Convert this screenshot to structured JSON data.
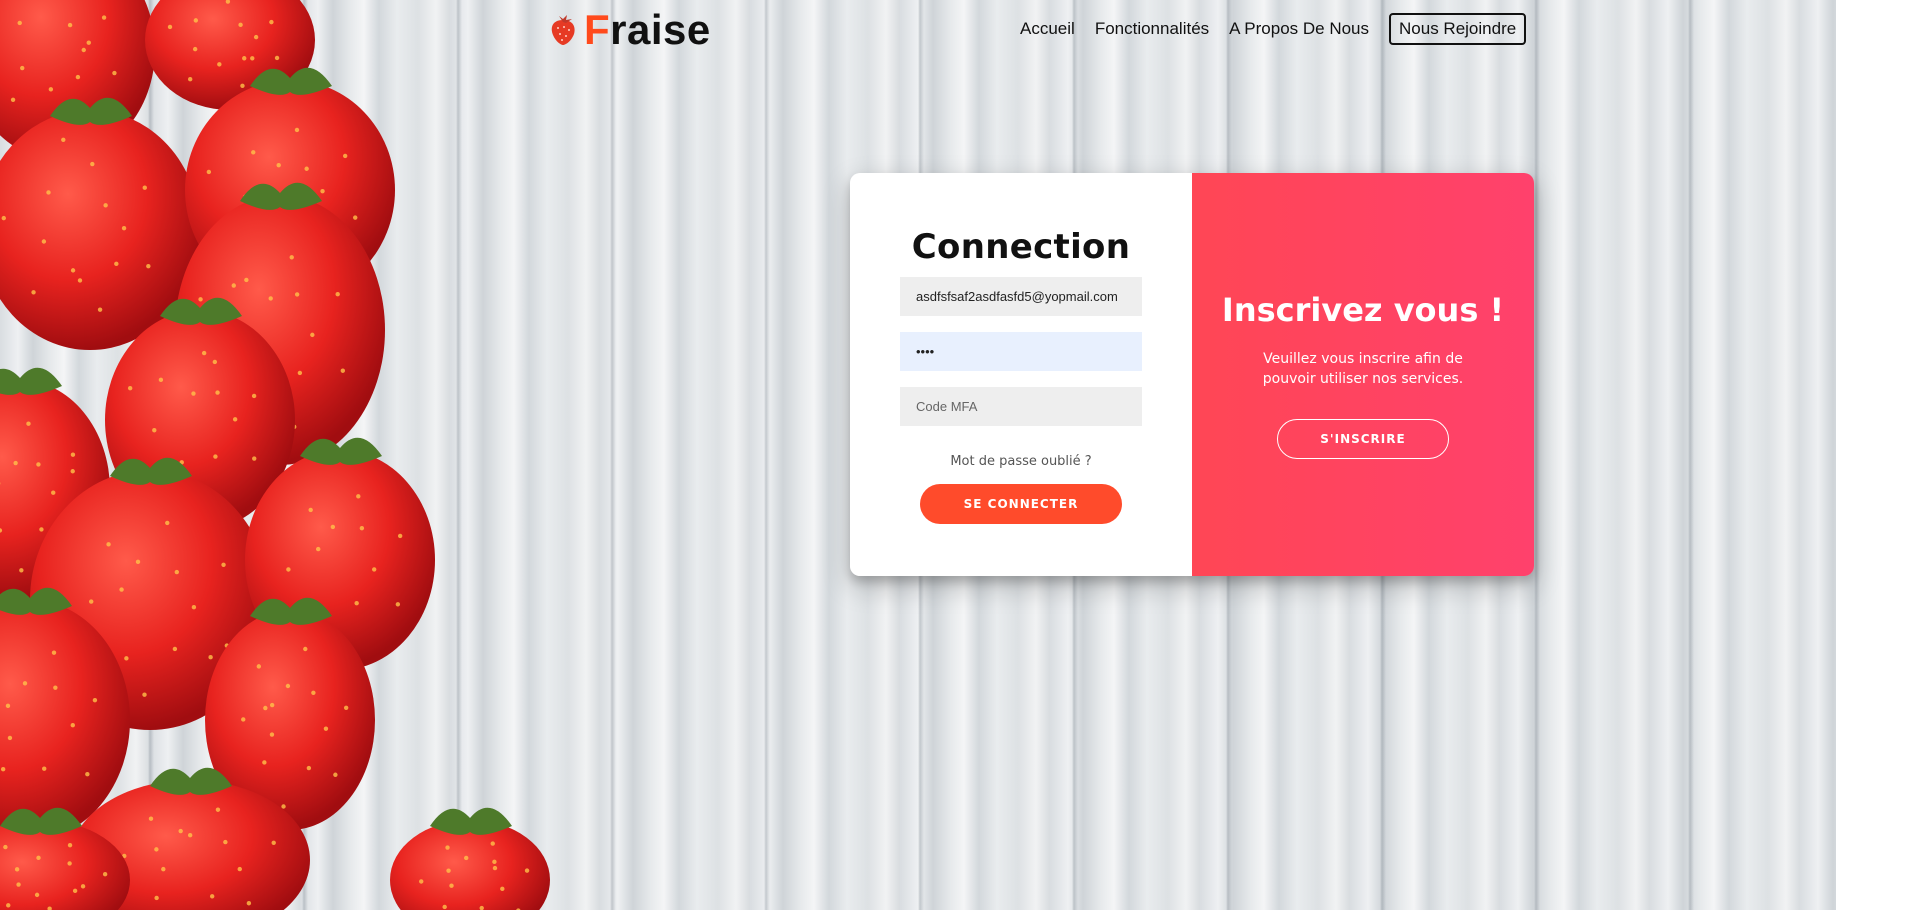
{
  "brand": {
    "first_letter": "F",
    "rest": "raise",
    "icon": "strawberry-icon"
  },
  "nav": {
    "items": [
      "Accueil",
      "Fonctionnalités",
      "A Propos De Nous"
    ],
    "cta": "Nous Rejoindre"
  },
  "login": {
    "title": "Connection",
    "email_value": "asdfsfsaf2asdfasfd5@yopmail.com",
    "password_value": "••••",
    "mfa_placeholder": "Code MFA",
    "forgot": "Mot de passe oublié ?",
    "submit": "SE CONNECTER"
  },
  "signup": {
    "title": "Inscrivez vous !",
    "text": "Veuillez vous inscrire afin de pouvoir utiliser nos services.",
    "button": "S'INSCRIRE"
  },
  "colors": {
    "accent": "#ff4b2b",
    "gradient_start": "#ff4655",
    "gradient_end": "#ff416c",
    "background_decor": "strawberries on white wood"
  }
}
